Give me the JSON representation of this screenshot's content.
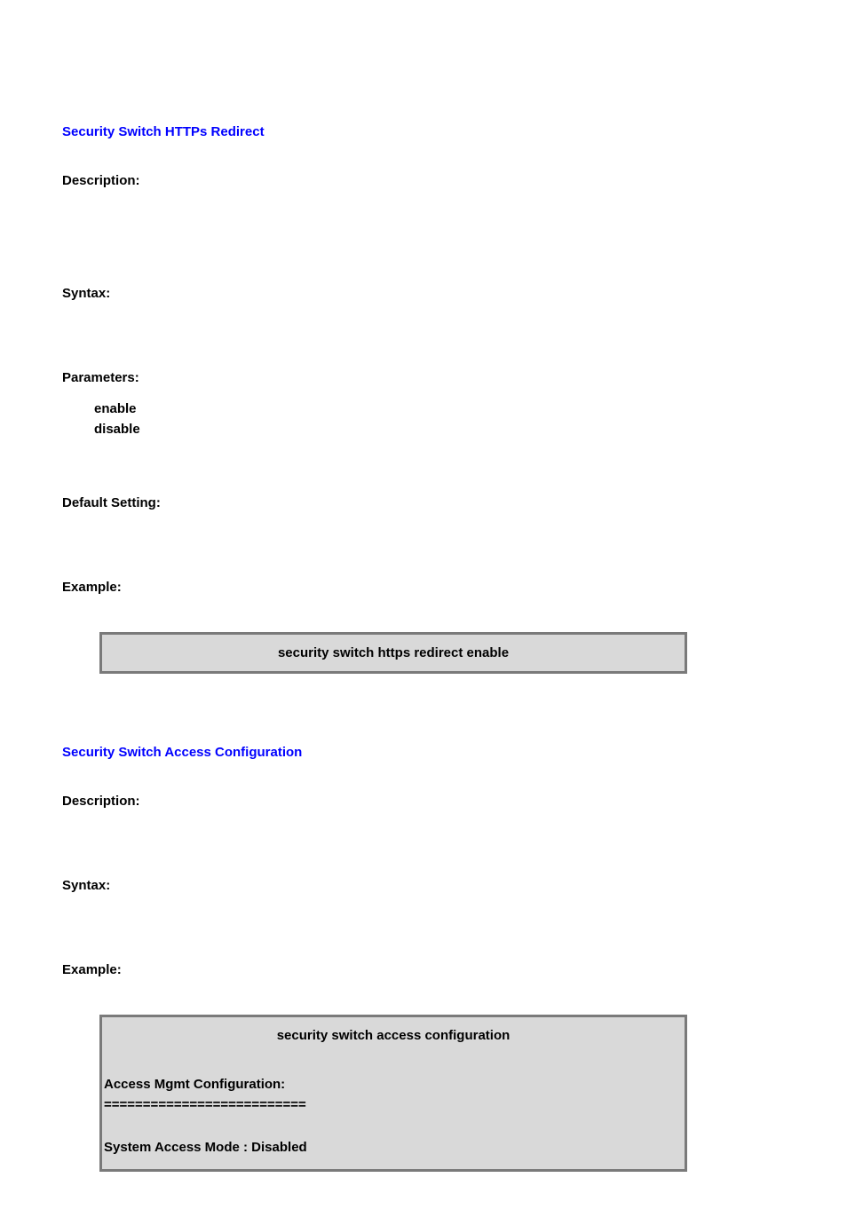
{
  "section1": {
    "title": "Security Switch HTTPs Redirect",
    "labels": {
      "description": "Description:",
      "syntax": "Syntax:",
      "parameters": "Parameters:",
      "default_setting": "Default Setting:",
      "example": "Example:"
    },
    "params": [
      "enable",
      "disable"
    ],
    "example_cmd": "security switch https redirect enable"
  },
  "section2": {
    "title": "Security Switch Access Configuration",
    "labels": {
      "description": "Description:",
      "syntax": "Syntax:",
      "example": "Example:"
    },
    "example_cmd": "security switch access configuration",
    "output_lines": [
      "Access Mgmt Configuration:",
      "==========================",
      "",
      "System Access Mode : Disabled"
    ]
  }
}
